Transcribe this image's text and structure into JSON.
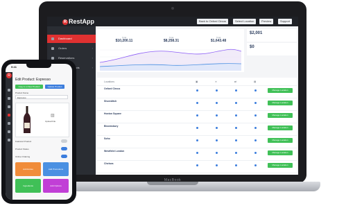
{
  "app": {
    "name": "RestApp",
    "logo_letter": "R"
  },
  "laptop": {
    "brand": "MacBook"
  },
  "topbar": {
    "buttons": [
      {
        "label": "Back to Oxford Circus"
      },
      {
        "label": "Select Location"
      },
      {
        "label": "Preview"
      },
      {
        "label": "Support"
      }
    ]
  },
  "sidebar": {
    "items": [
      {
        "label": "Dashboard",
        "active": true
      },
      {
        "label": "Orders"
      },
      {
        "label": "Reservations"
      },
      {
        "label": "Menu & Products"
      }
    ]
  },
  "stats": [
    {
      "label": "Total",
      "value": "$10,200.11"
    },
    {
      "label": "Total",
      "value": "$8,258.31"
    },
    {
      "label": "Total",
      "value": "$1,643.48"
    }
  ],
  "summary": [
    {
      "value": "$2,001",
      "label": ""
    },
    {
      "value": "$0",
      "label": ""
    }
  ],
  "table": {
    "header": {
      "location": "Locations"
    },
    "rows": [
      {
        "name": "Oxford Circus",
        "address": "",
        "button": "Manage Location"
      },
      {
        "name": "Shoreditch",
        "address": "",
        "button": "Manage Location"
      },
      {
        "name": "Hoxton Square",
        "address": "",
        "button": "Manage Location"
      },
      {
        "name": "Bloomsbury",
        "address": "",
        "button": "Manage Location"
      },
      {
        "name": "Soho",
        "address": "",
        "button": "Manage Location"
      },
      {
        "name": "Westfield London",
        "address": "",
        "button": "Manage Location"
      },
      {
        "name": "Chelsea",
        "address": "",
        "button": "Manage Location"
      }
    ]
  },
  "phone": {
    "time": "9:41",
    "title": "Edit Product: Espresso",
    "buttons": {
      "copy": "Copy to a New Product",
      "update": "Update Product"
    },
    "product_name_label": "Product Name",
    "product_name_value": "Espresso",
    "upload_label": "Upload File",
    "toggles": [
      {
        "label": "Featured Product",
        "on": false
      },
      {
        "label": "Product Status",
        "on": true
      },
      {
        "label": "Online Ordering",
        "on": true
      }
    ],
    "tiles": [
      {
        "label": "Add Extras",
        "color": "#f08c3a"
      },
      {
        "label": "Add Promotions",
        "color": "#4a90e2"
      },
      {
        "label": "Ingredients",
        "color": "#40c057"
      },
      {
        "label": "Add Options",
        "color": "#c13fd6"
      }
    ]
  },
  "colors": {
    "accent": "#e03131",
    "primary": "#3b7ddd",
    "success": "#40c057"
  }
}
